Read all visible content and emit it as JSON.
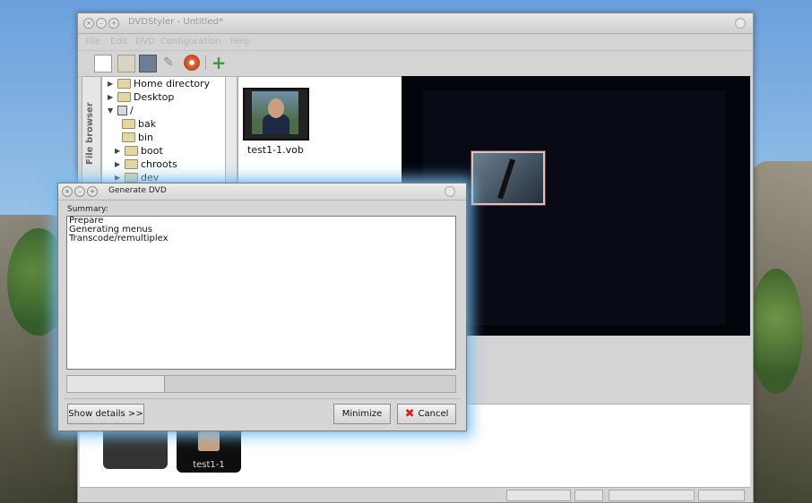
{
  "window": {
    "title": "DVDStyler - Untitled*",
    "menu": [
      "File",
      "Edit",
      "DVD",
      "Configuration",
      "Help"
    ]
  },
  "toolbar": {
    "icons": [
      "new-icon",
      "open-icon",
      "save-icon",
      "settings-icon",
      "burn-icon",
      "add-icon"
    ]
  },
  "file_browser": {
    "tab_label": "File browser",
    "tree": [
      {
        "label": "Home directory",
        "expanded": false
      },
      {
        "label": "Desktop",
        "expanded": false
      },
      {
        "label": "/",
        "expanded": true
      },
      {
        "label": "bak"
      },
      {
        "label": "bin"
      },
      {
        "label": "boot",
        "expanded": false
      },
      {
        "label": "chroots",
        "expanded": false
      },
      {
        "label": "dev",
        "expanded": false
      }
    ],
    "files": [
      {
        "name": "test1-1.vob"
      }
    ]
  },
  "titleset": {
    "items": [
      {
        "label": ""
      },
      {
        "label": "test1-1"
      }
    ]
  },
  "dialog": {
    "title": "Generate DVD",
    "summary_label": "Summary:",
    "summary_lines": [
      "Prepare",
      "Generating menus",
      "Transcode/remultiplex"
    ],
    "progress_fraction": 0.25,
    "show_details": "Show details >>",
    "minimize": "Minimize",
    "cancel": "Cancel"
  },
  "colors": {
    "glow": "#78bef0",
    "cancel_icon": "#d02424",
    "add_icon": "#3a9a3a"
  }
}
